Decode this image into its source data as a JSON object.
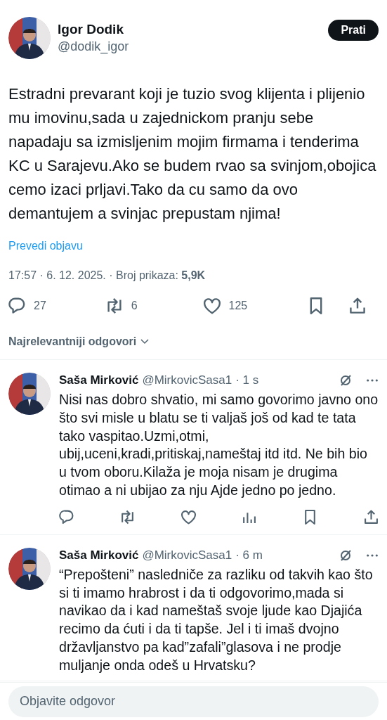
{
  "post": {
    "author": {
      "name": "Igor Dodik",
      "handle": "@dodik_igor"
    },
    "follow_button": "Prati",
    "text": "Estradni prevarant koji je tuzio svog klijenta i plijenio mu imovinu,sada u zajednickom pranju sebe napadaju sa izmisljenim mojim firmama i tenderima KC u Sarajevu.Ako se budem rvao sa svinjom,obojica cemo izaci prljavi.Tako da cu samo da ovo demantujem a svinjac prepustam njima!",
    "translate_link": "Prevedi objavu",
    "timestamp": "17:57 · 6. 12. 2025. · Broj prikaza: **5,9K**",
    "actions": [
      {
        "kind": "reply",
        "count": "27"
      },
      {
        "kind": "repost",
        "count": "6"
      },
      {
        "kind": "like",
        "count": "125"
      },
      {
        "kind": "bookmark"
      },
      {
        "kind": "share"
      }
    ]
  },
  "sort_menu": {
    "label": "Najrelevantniji odgovori"
  },
  "replies": [
    {
      "name": "Saša Mirković",
      "handle": "@MirkovicSasa1",
      "time": "· 1 s",
      "text": "Nisi nas dobro shvatio, mi samo govorimo javno ono što svi misle u blatu se ti valjaš još od kad te tata tako vaspitao.Uzmi,otmi, ubij,uceni,kradi,pritiskaj,nameštaj itd itd. Ne bih bio u tvom oboru.Kilaža je moja nisam je drugima otimao a ni ubijao za nju Ajde jedno  po jedno.",
      "actions": [
        {
          "kind": "reply"
        },
        {
          "kind": "repost"
        },
        {
          "kind": "like"
        },
        {
          "kind": "views"
        },
        {
          "kind": "bookmark"
        },
        {
          "kind": "share"
        }
      ]
    },
    {
      "name": "Saša Mirković",
      "handle": "@MirkovicSasa1",
      "time": "· 6 m",
      "text": "“Prepošteni” nasledniče za razliku od takvih kao što si ti imamo hrabrost i da ti odgovorimo,mada si navikao da i kad nameštaš svoje ljude kao Djajića recimo da ćuti i da ti tapše. Jel i ti imaš dvojno državljanstvo pa kad”zafali”glasova i ne prodje muljanje onda odeš u Hrvatsku?"
    }
  ],
  "reply_field": {
    "placeholder": "Objavite odgovor"
  }
}
